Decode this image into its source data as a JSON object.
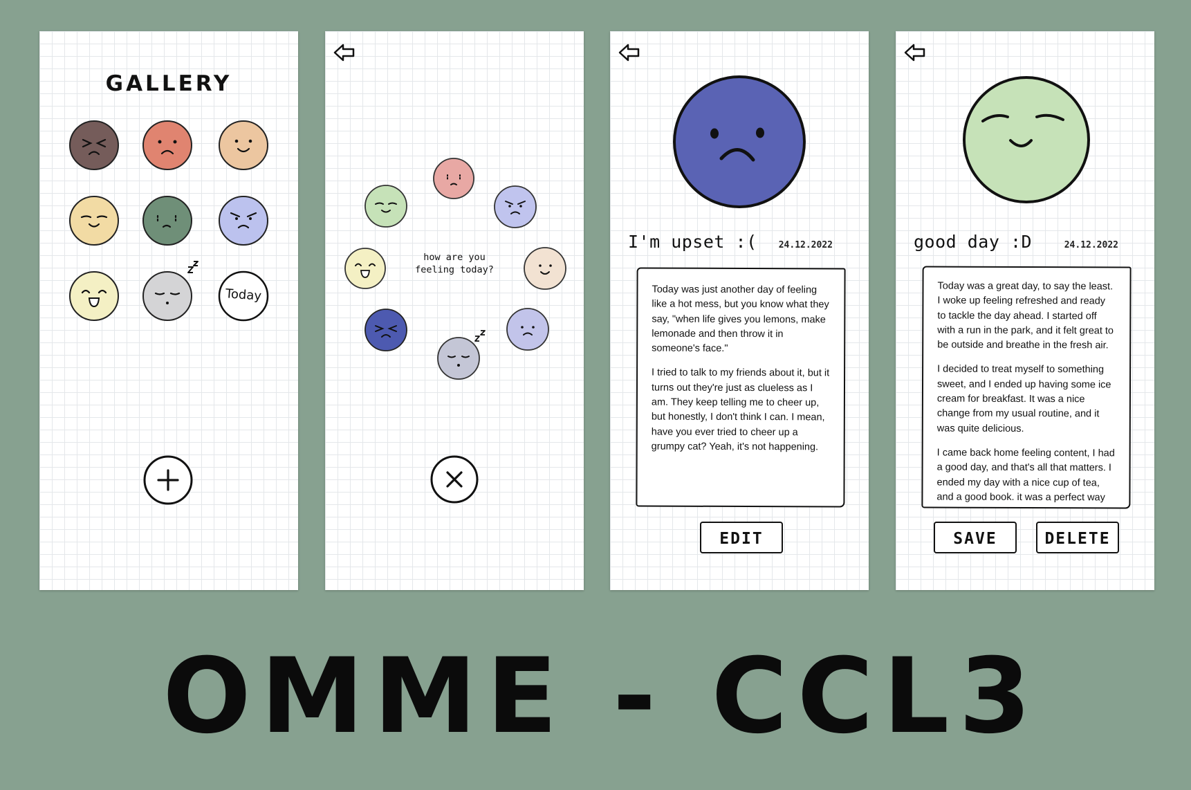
{
  "caption": "OMME - CCL3",
  "colors": {
    "background": "#87a190",
    "brown": "#755c5a",
    "coral": "#e08470",
    "peach": "#ecc6a0",
    "yellow": "#f2dba4",
    "sage": "#6f8f78",
    "lavender": "#bcc2ee",
    "pale_yellow": "#f4f0c4",
    "grey": "#d4d4d6",
    "pink": "#e8a8a4",
    "mint": "#c6e2b8",
    "cream": "#f2e2d2",
    "navy": "#4d5ab0",
    "periwinkle": "#c2c4ea",
    "blue_grey": "#c4c6d6"
  },
  "gallery": {
    "title": "GALLERY",
    "today_label": "Today",
    "add_icon": "plus-icon"
  },
  "picker": {
    "prompt_line1": "how are you",
    "prompt_line2": "feeling today?",
    "close_icon": "x-icon"
  },
  "entry_upset": {
    "title": "I'm upset :(",
    "date": "24.12.2022",
    "paragraphs": [
      "Today was just another day of feeling like a hot mess, but you know what they say, \"when life gives you lemons, make lemonade and then throw it in someone's face.\"",
      "I tried to talk to my friends about it, but it turns out they're just as clueless as I am. They keep telling me to cheer up, but honestly, I don't think I can. I mean, have you ever tried to cheer up a grumpy cat? Yeah, it's not happening."
    ],
    "edit_label": "EDIT"
  },
  "entry_good": {
    "title": "good day :D",
    "date": "24.12.2022",
    "paragraphs": [
      "Today was a great day, to say the least. I woke up feeling refreshed and ready to tackle the day ahead. I started off with a run in the park, and it felt great to be outside and breathe in the fresh air.",
      "I decided to treat myself to something sweet, and I ended up having some ice cream for breakfast. It was a nice change from my usual routine, and it was quite delicious.",
      "I came back home feeling content, I had a good day, and that's all that matters. I ended my day with a nice cup of tea, and a good book. it was a perfect way"
    ],
    "save_label": "SAVE",
    "delete_label": "DELETE"
  }
}
